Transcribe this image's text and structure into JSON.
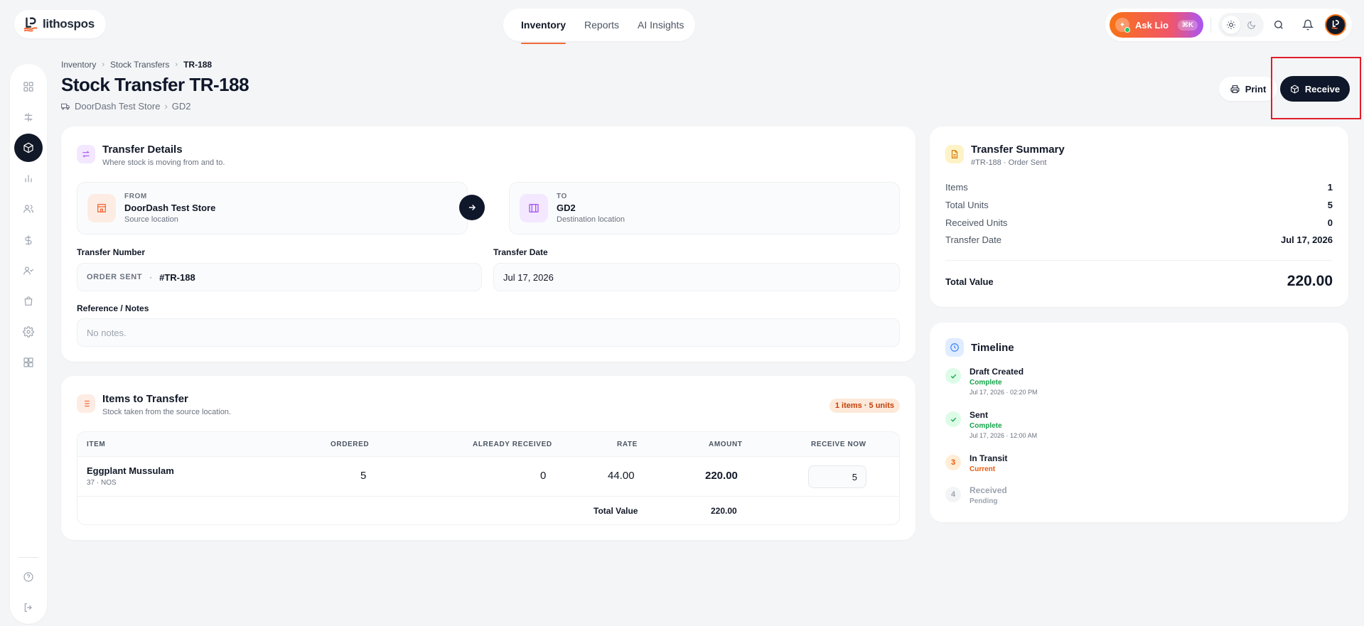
{
  "app": {
    "logo_text": "lithospos"
  },
  "topnav": {
    "tabs": [
      {
        "label": "Inventory"
      },
      {
        "label": "Reports"
      },
      {
        "label": "AI Insights"
      }
    ]
  },
  "topright": {
    "ask_label": "Ask Lio",
    "ask_shortcut": "⌘K"
  },
  "sidebar": {
    "icons": [
      "dashboard-icon",
      "pos-icon",
      "inventory-icon",
      "reports-icon",
      "customers-icon",
      "finance-icon",
      "staff-icon",
      "store-icon",
      "settings-icon",
      "apps-icon",
      "help-icon",
      "logout-icon"
    ]
  },
  "breadcrumb": {
    "items": [
      "Inventory",
      "Stock Transfers",
      "TR-188"
    ]
  },
  "page": {
    "title": "Stock Transfer TR-188",
    "from": "DoorDash Test Store",
    "to": "GD2"
  },
  "actions": {
    "print_label": "Print",
    "receive_label": "Receive"
  },
  "transfer_details": {
    "title": "Transfer Details",
    "subtitle": "Where stock is moving from and to.",
    "from": {
      "kicker": "FROM",
      "name": "DoorDash Test Store",
      "sub": "Source location"
    },
    "to": {
      "kicker": "TO",
      "name": "GD2",
      "sub": "Destination location"
    },
    "number_label": "Transfer Number",
    "number_status": "ORDER SENT",
    "number_separator": "·",
    "number_value": "#TR-188",
    "date_label": "Transfer Date",
    "date_value": "Jul 17, 2026",
    "notes_label": "Reference / Notes",
    "notes_placeholder": "No notes."
  },
  "items": {
    "title": "Items to Transfer",
    "subtitle": "Stock taken from the source location.",
    "badge": "1 items · 5 units",
    "columns": [
      "ITEM",
      "ORDERED",
      "ALREADY RECEIVED",
      "RATE",
      "AMOUNT",
      "RECEIVE NOW"
    ],
    "rows": [
      {
        "name": "Eggplant Mussulam",
        "sub": "37 · NOS",
        "ordered": "5",
        "received": "0",
        "rate": "44.00",
        "amount": "220.00",
        "receive_now": "5"
      }
    ],
    "total_label": "Total Value",
    "total_value": "220.00"
  },
  "summary": {
    "title": "Transfer Summary",
    "subtitle": "#TR-188 · Order Sent",
    "rows": [
      {
        "k": "Items",
        "v": "1"
      },
      {
        "k": "Total Units",
        "v": "5"
      },
      {
        "k": "Received Units",
        "v": "0"
      },
      {
        "k": "Transfer Date",
        "v": "Jul 17, 2026"
      }
    ],
    "total_label": "Total Value",
    "total_value": "220.00"
  },
  "timeline": {
    "title": "Timeline",
    "steps": [
      {
        "name": "Draft Created",
        "status": "Complete",
        "time": "Jul 17, 2026 · 02:20 PM"
      },
      {
        "name": "Sent",
        "status": "Complete",
        "time": "Jul 17, 2026 · 12:00 AM"
      },
      {
        "num": "3",
        "name": "In Transit",
        "status": "Current"
      },
      {
        "num": "4",
        "name": "Received",
        "status": "Pending"
      }
    ]
  },
  "colors": {
    "accent": "#f26b3a",
    "dark": "#0f172a",
    "success": "#16a34a",
    "current": "#ea580c",
    "highlight_frame": "#e11d2a"
  }
}
